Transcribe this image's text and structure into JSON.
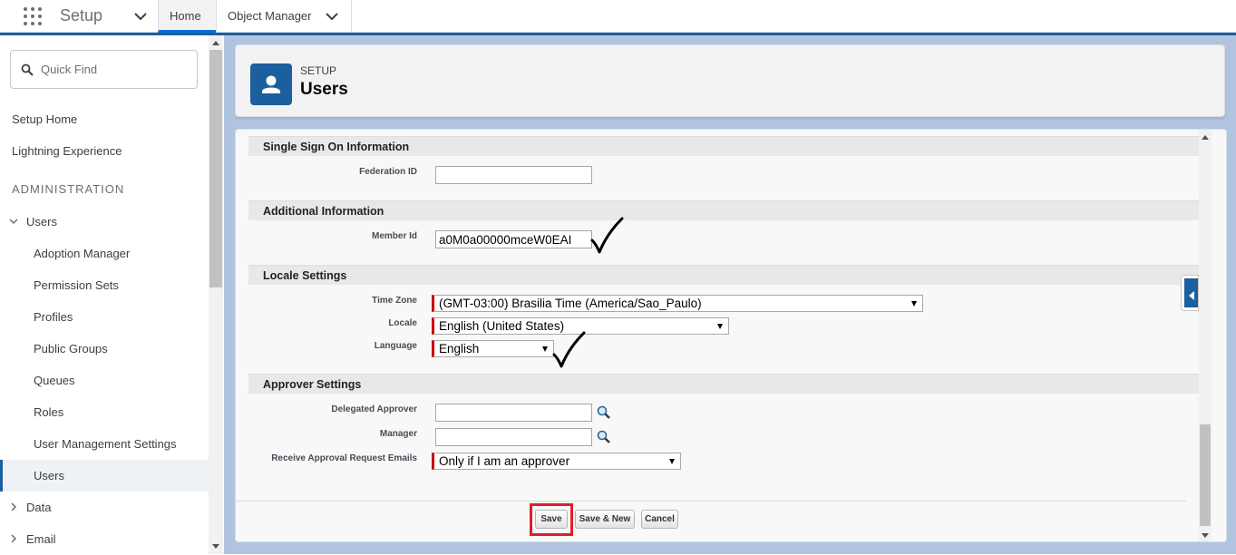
{
  "topbar": {
    "app_name": "Setup",
    "tabs": [
      {
        "label": "Home"
      },
      {
        "label": "Object Manager"
      }
    ]
  },
  "sidebar": {
    "search_placeholder": "Quick Find",
    "items": [
      {
        "label": "Setup Home"
      },
      {
        "label": "Lightning Experience"
      }
    ],
    "section_header": "ADMINISTRATION",
    "users_group": "Users",
    "sub_items": [
      {
        "label": "Adoption Manager"
      },
      {
        "label": "Permission Sets"
      },
      {
        "label": "Profiles"
      },
      {
        "label": "Public Groups"
      },
      {
        "label": "Queues"
      },
      {
        "label": "Roles"
      },
      {
        "label": "User Management Settings"
      },
      {
        "label": "Users"
      }
    ],
    "groups_after": [
      {
        "label": "Data"
      },
      {
        "label": "Email"
      }
    ]
  },
  "header": {
    "eyebrow": "SETUP",
    "title": "Users"
  },
  "form": {
    "sections": {
      "sso": "Single Sign On Information",
      "additional": "Additional Information",
      "locale": "Locale Settings",
      "approver": "Approver Settings"
    },
    "fields": {
      "federation_id": {
        "label": "Federation ID",
        "value": ""
      },
      "member_id": {
        "label": "Member Id",
        "value": "a0M0a00000mceW0EAI"
      },
      "time_zone": {
        "label": "Time Zone",
        "value": "(GMT-03:00) Brasilia Time (America/Sao_Paulo)"
      },
      "locale": {
        "label": "Locale",
        "value": "English (United States)"
      },
      "language": {
        "label": "Language",
        "value": "English"
      },
      "delegated_approver": {
        "label": "Delegated Approver",
        "value": ""
      },
      "manager": {
        "label": "Manager",
        "value": ""
      },
      "receive_approval": {
        "label": "Receive Approval Request Emails",
        "value": "Only if I am an approver"
      }
    },
    "buttons": {
      "save": "Save",
      "save_new": "Save & New",
      "cancel": "Cancel"
    }
  },
  "colors": {
    "brand": "#1b5f9e",
    "required_marker": "#cc0000",
    "highlight": "#e01e28",
    "page_background": "#b0c4df"
  }
}
